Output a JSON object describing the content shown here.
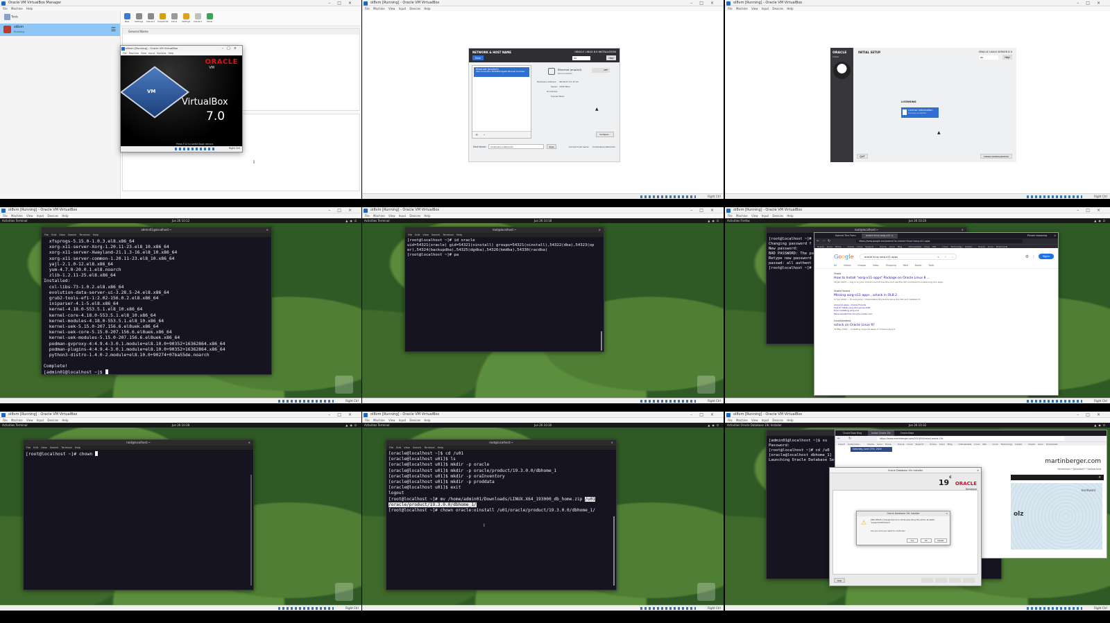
{
  "colors": {
    "accent": "#2f6fd0",
    "terminal_bg": "#171421",
    "desktop_green": "#2f5a25",
    "oracle_red": "#c8102e"
  },
  "host_key": "Right Ctrl",
  "cells": {
    "c1": {
      "title": "Oracle VM VirtualBox Manager",
      "menu": "File  Machine  Help",
      "tools_label": "Tools",
      "vm_name": "ol8vm",
      "vm_state": "Running",
      "toolbar": [
        "New",
        "Settings",
        "Discard",
        "Snapshots",
        "Clone",
        "Settings",
        "Discard",
        "Show"
      ],
      "preview_label": "General  Name",
      "inner_title": "ol8vm [Running] - Oracle VM VirtualBox",
      "inner_menu": "File  Machine  View  Input  Devices  Help",
      "splash_brand": "ORACLE",
      "splash_vm": "VM",
      "splash_product": "VirtualBox",
      "splash_version": "7.0",
      "splash_hint": "Press F12 to select boot device."
    },
    "c2": {
      "title": "ol8vm [Running] - Oracle VM VirtualBox",
      "menu": "File  Machine  View  Input  Devices  Help",
      "header": "NETWORK & HOST NAME",
      "header_right": "ORACLE LINUX 8.9 INSTALLATION",
      "done": "Done",
      "help": "Help!",
      "iface_title": "Ethernet (enp0s3)",
      "iface_sub": "Intel Corporation 82540EM Gigabit Ethernet Controller",
      "iface_status": "Disconnected",
      "hw_label": "Hardware Address",
      "hw_value": "08:00:27:47:1F:2A",
      "speed_label": "Speed",
      "speed_value": "1000 Mb/s",
      "ip_label": "IP Address",
      "mask_label": "Subnet Mask",
      "configure": "Configure...",
      "hostname_label": "Host Name:",
      "hostname_value": "localhost.localdomain",
      "apply": "Apply",
      "current_label": "Current host name:",
      "current_value": "localhost.localdomain",
      "toggle": "OFF"
    },
    "c3": {
      "title": "ol8vm [Running] - Oracle VM VirtualBox",
      "menu": "File  Machine  View  Input  Devices  Help",
      "brand": "ORACLE",
      "brand_sub": "Linux",
      "heading": "INITIAL SETUP",
      "heading_right": "ORACLE LINUX SERVER 8.9",
      "licensing": "LICENSING",
      "license_item": "License Information",
      "license_sub": "License accepted",
      "quit": "QUIT",
      "finish": "FINISH CONFIGURATION",
      "help": "Help!"
    },
    "c4": {
      "title": "ol8vm [Running] - Oracle VM VirtualBox",
      "menu": "File  Machine  View  Input  Devices  Help",
      "activities": "Activities   Terminal",
      "clock": "Jun 26 10:12",
      "term_title": "admin01@localhost:~",
      "term_menu": "File  Edit  View  Search  Terminal  Help",
      "lines": [
        "  xfsprogs-5.15.0-1.0.3.el8.x86_64",
        "  xorg-x11-server-Xorg-1.20.11-23.el8_10.x86_64",
        "  xorg-x11-server-Xwayland-21.1.3-16.el8_10.x86_64",
        "  xorg-x11-server-common-1.20.11-23.el8_10.x86_64",
        "  yajl-2.1.0-12.el8.x86_64",
        "  yum-4.7.0-20.0.1.el8.noarch",
        "  zlib-1.2.11-25.el8.x86_64",
        "Installed:",
        "  cxl-libs-73-1.0.2.el8.x86_64",
        "  evolution-data-server-ui-3.28.5-24.el8.x86_64",
        "  grub2-tools-efi-1:2.02-156.0.2.el8.x86_64",
        "  iniparser-4.1-5.el8.x86_64",
        "  kernel-4.18.0-553.5.1.el8_10.x86_64",
        "  kernel-core-4.18.0-553.5.1.el8_10.x86_64",
        "  kernel-modules-4.18.0-553.5.1.el8_10.x86_64",
        "  kernel-uek-5.15.0-207.156.6.el8uek.x86_64",
        "  kernel-uek-core-5.15.0-207.156.6.el8uek.x86_64",
        "  kernel-uek-modules-5.15.0-207.156.6.el8uek.x86_64",
        "  podman-gvproxy-4:4.9.4-3.0.1.module+el8.10.0+90352+16362864.x86_64",
        "  podman-plugins-4:4.9.4-3.0.1.module+el8.10.0+90352+16362864.x86_64",
        "  python3-distro-1.4.0-2.module+el8.10.0+90274+07ba55de.noarch",
        "",
        "Complete!",
        "[admin01@localhost ~]$ "
      ]
    },
    "c5": {
      "title": "ol8vm [Running] - Oracle VM VirtualBox",
      "menu": "File  Machine  View  Input  Devices  Help",
      "activities": "Activities   Terminal",
      "clock": "Jun 26 10:18",
      "term_title": "root@localhost:~",
      "term_menu": "File  Edit  View  Search  Terminal  Help",
      "lines": [
        "[root@localhost ~]# id oracle",
        "uid=54321(oracle) gid=54321(oinstall) groups=54321(oinstall),54322(dba),54323(op",
        "er),54324(backupdba),54325(dgdba),54326(kmdba),54330(racdba)",
        "[root@localhost ~]# pa"
      ]
    },
    "c6": {
      "title": "ol8vm [Running] - Oracle VM VirtualBox",
      "menu": "File  Machine  View  Input  Devices  Help",
      "activities": "Activities   Firefox",
      "clock": "Jun 26 10:20",
      "term_title": "root@localhost:~",
      "term_lines": [
        "[root@localhost ~]# ",
        "Changing password f",
        "New password:",
        "BAD PASSWORD: The pa",
        "Retype new password",
        "passwd: all authent",
        "[root@localhost ~]#"
      ],
      "tab1": "Submit This Form",
      "tab2": "oracle linux xorg-x11 ×",
      "url": "https://www.google.com/search?q=oracle+linux+xorg-x11-apps",
      "search_query": "oracle linux xorg-x11-apps",
      "sign_in": "Sign in",
      "filters": [
        "All",
        "Videos",
        "Images",
        "News",
        "Shopping",
        "Web",
        "Books",
        "Tools"
      ],
      "results": [
        {
          "source": "Oracle",
          "title": "How to Install \"xorg-x11-apps\" Package on Oracle Linux 8 ...",
          "snippet": "16 Jan 2023 — Log in to your Oracle Linux 8 machine and use the dnf command to install xorg-x11-apps."
        },
        {
          "source": "Oracle Forums",
          "title": "Missing xorg-x11-apps , xclock in OL8.2",
          "snippet": "17 Jun 2020 — Hi everyone, I downloaded the Oracle Linux 8.2 ISO and installed it."
        },
        {
          "source": "LinuxQuestions",
          "title": "xclock on Oracle Linux 9?",
          "snippet": "19 May 2022 — Installing xorg-x11-apps on Oracle Linux 9."
        }
      ],
      "related": [
        "xorg-x11-apps - Oracle Forums",
        "how to install xorg-x11-server-Xvfb",
        "Error installing xorg-x11",
        "More results from forums.oracle.com"
      ]
    },
    "c7": {
      "title": "ol8vm [Running] - Oracle VM VirtualBox",
      "menu": "File  Machine  View  Input  Devices  Help",
      "activities": "Activities   Terminal",
      "clock": "Jun 26 10:28",
      "term_title": "root@localhost:~",
      "term_menu": "File  Edit  View  Search  Terminal  Help",
      "lines": [
        "[root@localhost ~]# chown "
      ]
    },
    "c8": {
      "title": "ol8vm [Running] - Oracle VM VirtualBox",
      "menu": "File  Machine  View  Input  Devices  Help",
      "activities": "Activities   Terminal",
      "clock": "Jun 26 10:30",
      "term_title": "root@localhost:~",
      "term_menu": "File  Edit  View  Search  Terminal  Help",
      "lines": [
        "[oracle@localhost ~]$ cd /u01",
        "[oracle@localhost u01]$ ls",
        "[oracle@localhost u01]$ mkdir -p oracle",
        "[oracle@localhost u01]$ mkdir -p oracle/product/19.3.0.0/dbhome_1",
        "[oracle@localhost u01]$ mkdir -p oraInventory",
        "[oracle@localhost u01]$ mkdir -p proddata",
        "[oracle@localhost u01]$ exit",
        "logout"
      ],
      "mv_cmd": "[root@localhost ~]# mv /home/admin01/Downloads/LINUX.X64_193000_db_home.zip ",
      "mv_hl1": "/u01",
      "mv_hl2": "/oracle/product/19.3.0.0/dbhome_1/",
      "chown_cmd": "[root@localhost ~]# chown oracle:oinstall /u01/oracle/product/19.3.0.0/dbhome_1/"
    },
    "c9": {
      "title": "ol8vm [Running] - Oracle VM VirtualBox",
      "menu": "File  Machine  View  Input  Devices  Help",
      "activities": "Activities   Oracle Database 19c Installer",
      "clock": "Jun 26 10:32",
      "term_lines": [
        "[admin01@localhost ~]$ su",
        "Password:",
        "[root@localhost ~]# cd /u0",
        "[oracle@localhost dbhome_1]",
        "Launching Oracle Database Set"
      ],
      "tabs": [
        "Oracle Base Blog",
        "Install Oracle 19c",
        "Oracle Base"
      ],
      "url": "https://www.martinberger.com/2019/04/install-oracle-19c",
      "date_bar": "Saturday, June 27th, 2024",
      "site": "martinberger.com",
      "site_sub": "Kerzenholz • Jonasdorf • Switzerland",
      "installer_title": "Oracle Database 19c Installer",
      "brand_19c": "19",
      "brand_c": "c",
      "brand_oracle": "ORACLE",
      "brand_db": "Database",
      "dialog_title": "Oracle Database 19c Installer",
      "dialog_msg": "[INS-08101] Unexpected error while executing the action at state: 'supportedOSCheck'",
      "dialog_q": "Are you sure you want to continue?",
      "btn_yes": "Yes",
      "btn_no": "No",
      "btn_details": "Details",
      "help": "Help",
      "map_city": "olz",
      "map_label": "Hardtwald"
    }
  }
}
